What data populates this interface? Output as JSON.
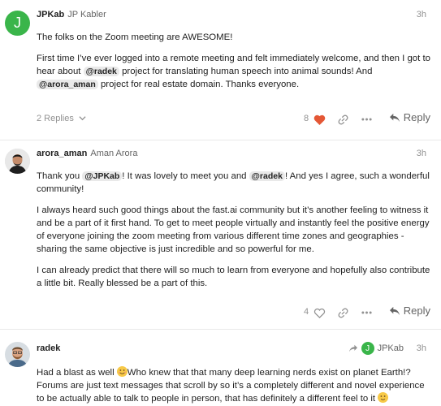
{
  "posts": [
    {
      "avatar_letter": "J",
      "avatar_color": "#3ab54a",
      "username": "JPKab",
      "fullname": "JP Kabler",
      "time": "3h",
      "p1": "The folks on the Zoom meeting are AWESOME!",
      "p2_a": "First time I’ve ever logged into a remote meeting and felt immediately welcome, and then I got to hear about ",
      "p2_m1": "@radek",
      "p2_b": " project for translating human speech into animal sounds! And ",
      "p2_m2": "@arora_aman",
      "p2_c": " project for real estate domain. Thanks everyone.",
      "replies": "2 Replies",
      "likes": "8",
      "reply_label": "Reply"
    },
    {
      "username": "arora_aman",
      "fullname": "Aman Arora",
      "time": "3h",
      "p1_a": "Thank you ",
      "p1_m1": "@JPKab",
      "p1_b": "! It was lovely to meet you and ",
      "p1_m2": "@radek",
      "p1_c": "! And yes I agree, such a wonderful community!",
      "p2": "I always heard such good things about the fast.ai community but it’s another feeling to witness it and be a part of it first hand. To get to meet people virtually and instantly feel the positive energy of everyone joining the zoom meeting from various different time zones and geographies - sharing the same objective is just incredible and so powerful for me.",
      "p3": "I can already predict that there will so much to learn from everyone and hopefully also contribute a little bit. Really blessed be a part of this.",
      "likes": "4",
      "reply_label": "Reply"
    },
    {
      "username": "radek",
      "time": "3h",
      "reply_to": "JPKab",
      "reply_to_letter": "J",
      "p1_a": "Had a blast as well ",
      "p1_b": "Who knew that that many deep learning nerds exist on planet Earth!? Forums are just text messages that scroll by so it’s a completely different and novel experience to be actually able to talk to people in person, that has definitely a different feel to it "
    }
  ],
  "colors": {
    "accent_green": "#3ab54a",
    "heart_red": "#e45735",
    "muted": "#919191",
    "mention_bg": "#e9e9e9"
  }
}
